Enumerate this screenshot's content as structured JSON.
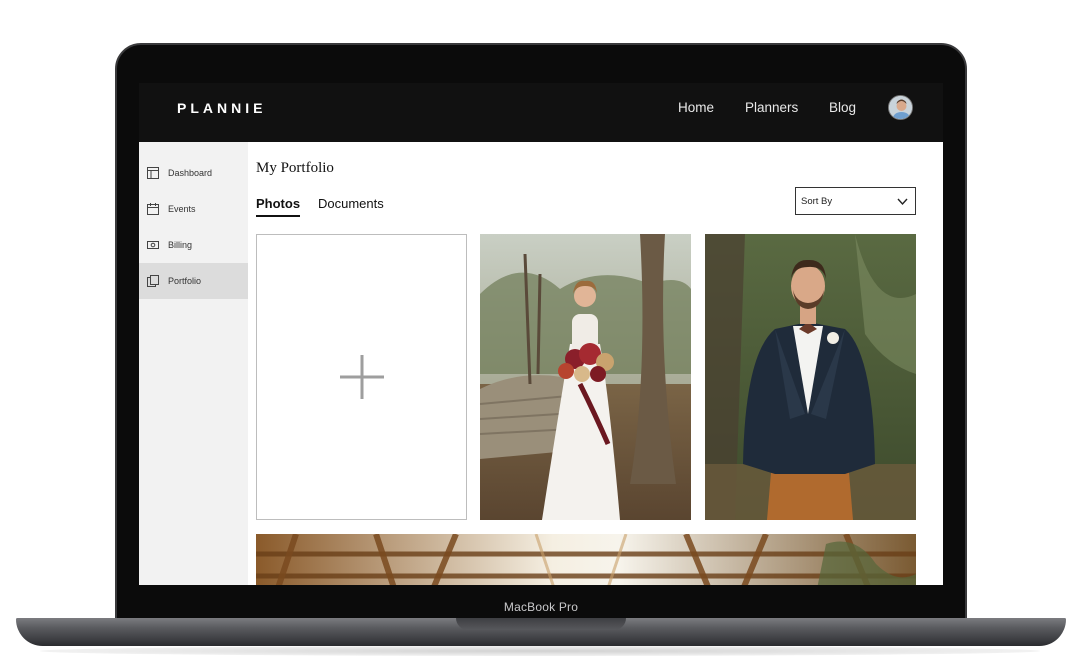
{
  "device": {
    "brand_label": "MacBook Pro"
  },
  "header": {
    "logo": "PLANNIE",
    "nav": [
      "Home",
      "Planners",
      "Blog"
    ]
  },
  "sidebar": {
    "items": [
      {
        "label": "Dashboard",
        "icon": "layout-icon"
      },
      {
        "label": "Events",
        "icon": "calendar-icon"
      },
      {
        "label": "Billing",
        "icon": "money-icon"
      },
      {
        "label": "Portfolio",
        "icon": "copy-icon",
        "active": true
      }
    ]
  },
  "main": {
    "title": "My Portfolio",
    "tabs": [
      {
        "label": "Photos",
        "active": true
      },
      {
        "label": "Documents",
        "active": false
      }
    ],
    "sort": {
      "label": "Sort By"
    }
  },
  "colors": {
    "header_bg": "#111111",
    "sidebar_bg": "#f2f2f2",
    "active_item_bg": "#dcdcdc",
    "plus_icon": "#9e9e9e"
  }
}
